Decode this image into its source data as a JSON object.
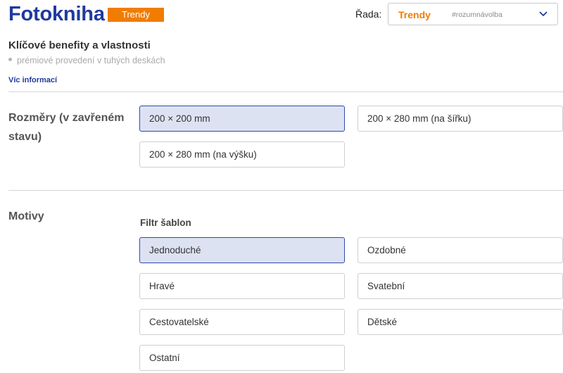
{
  "header": {
    "title": "Fotokniha",
    "badge": "Trendy",
    "series_label": "Řada:",
    "series_select": {
      "value": "Trendy",
      "hashtag": "#rozumnávolba",
      "icon": "chevron-down-icon"
    }
  },
  "benefits": {
    "heading": "Klíčové benefity a vlastnosti",
    "items": [
      "prémiové provedení v tuhých deskách"
    ],
    "more_link": "Víc informací"
  },
  "dimensions": {
    "label": "Rozměry (v zavřeném stavu)",
    "label_line1": "Rozměry (v zavřeném",
    "label_line2": "stavu)",
    "options": [
      {
        "label": "200 × 200 mm",
        "selected": true
      },
      {
        "label": "200 × 280 mm (na šířku)",
        "selected": false
      },
      {
        "label": "200 × 280 mm (na výšku)",
        "selected": false
      }
    ]
  },
  "motifs": {
    "label": "Motivy",
    "filter_label": "Filtr šablon",
    "options": [
      {
        "label": "Jednoduché",
        "selected": true
      },
      {
        "label": "Ozdobné",
        "selected": false
      },
      {
        "label": "Hravé",
        "selected": false
      },
      {
        "label": "Svatební",
        "selected": false
      },
      {
        "label": "Cestovatelské",
        "selected": false
      },
      {
        "label": "Dětské",
        "selected": false
      },
      {
        "label": "Ostatní",
        "selected": false
      }
    ]
  },
  "colors": {
    "brand_blue": "#1f3a9e",
    "accent_orange": "#f07d00",
    "selected_bg": "#dde2f3"
  }
}
